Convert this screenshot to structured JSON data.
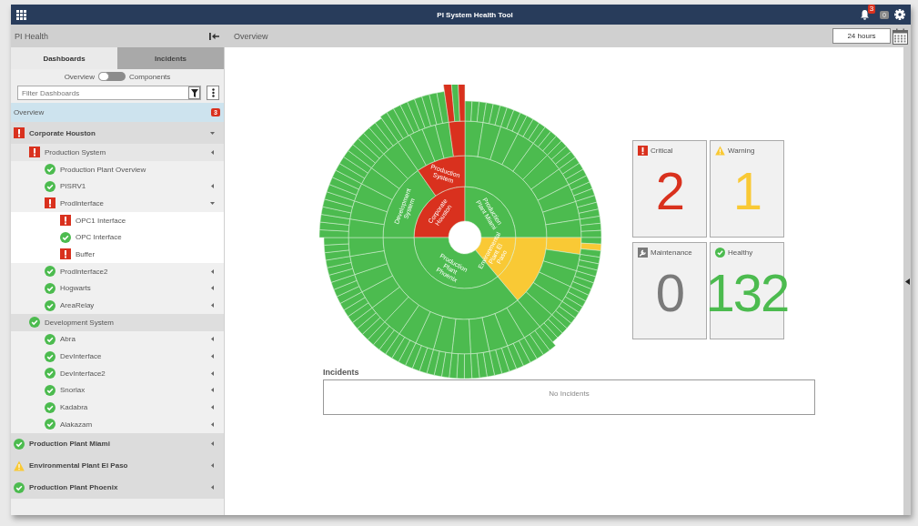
{
  "window": {
    "title": "PI System Health Tool"
  },
  "top_bar": {
    "notification_count": "3",
    "counter": "0"
  },
  "sidebar": {
    "title": "PI Health",
    "tabs": [
      {
        "label": "Dashboards",
        "selected": true
      },
      {
        "label": "Incidents",
        "selected": false
      }
    ],
    "toggle": {
      "left_label": "Overview",
      "right_label": "Components",
      "on": false
    },
    "filter": {
      "placeholder": "Filter Dashboards"
    },
    "overview": {
      "label": "Overview",
      "badge": "3",
      "selected": true
    },
    "tree": [
      {
        "label": "Corporate Houston",
        "kind": "critical",
        "expanded": true,
        "children": [
          {
            "label": "Production System",
            "kind": "critical",
            "expanded": false,
            "children": [
              {
                "label": "Production Plant Overview",
                "kind": "healthy"
              },
              {
                "label": "PISRV1",
                "kind": "healthy",
                "expanded": false
              },
              {
                "label": "ProdInterface",
                "kind": "critical",
                "expanded": true,
                "children": [
                  {
                    "label": "OPC1 Interface",
                    "kind": "critical"
                  },
                  {
                    "label": "OPC Interface",
                    "kind": "healthy"
                  },
                  {
                    "label": "Buffer",
                    "kind": "critical"
                  }
                ]
              },
              {
                "label": "ProdInterface2",
                "kind": "healthy",
                "expanded": false
              },
              {
                "label": "Hogwarts",
                "kind": "healthy",
                "expanded": false
              },
              {
                "label": "AreaRelay",
                "kind": "healthy",
                "expanded": false
              }
            ]
          },
          {
            "label": "Development System",
            "kind": "healthy",
            "children": [
              {
                "label": "Abra",
                "kind": "healthy",
                "expanded": false
              },
              {
                "label": "DevInterface",
                "kind": "healthy",
                "expanded": false
              },
              {
                "label": "DevInterface2",
                "kind": "healthy",
                "expanded": false
              },
              {
                "label": "Snorlax",
                "kind": "healthy",
                "expanded": false
              },
              {
                "label": "Kadabra",
                "kind": "healthy",
                "expanded": false
              },
              {
                "label": "Alakazam",
                "kind": "healthy",
                "expanded": false
              }
            ]
          }
        ]
      },
      {
        "label": "Production Plant Miami",
        "kind": "healthy",
        "expanded": false
      },
      {
        "label": "Environmental Plant El Paso",
        "kind": "warning",
        "expanded": false
      },
      {
        "label": "Production Plant Phoenix",
        "kind": "healthy",
        "expanded": false
      }
    ]
  },
  "header": {
    "title": "Overview",
    "range": "24 hours"
  },
  "sunburst": {
    "segments": [
      {
        "label": "Corporate Houston",
        "kind": "critical"
      },
      {
        "label": "Production Plant Miami",
        "kind": "healthy"
      },
      {
        "label": "Environmental Plant El Paso",
        "kind": "warning"
      },
      {
        "label": "Production Plant Phoenix",
        "kind": "healthy"
      }
    ],
    "subsegments": [
      {
        "label": "Development System",
        "kind": "healthy"
      },
      {
        "label": "Production System",
        "kind": "critical"
      }
    ]
  },
  "summary": [
    {
      "label": "Critical",
      "kind": "critical",
      "count": "2"
    },
    {
      "label": "Warning",
      "kind": "warning",
      "count": "1"
    },
    {
      "label": "Maintenance",
      "kind": "maintenance",
      "count": "0"
    },
    {
      "label": "Healthy",
      "kind": "healthy",
      "count": "132"
    }
  ],
  "incidents": {
    "title": "Incidents",
    "empty_text": "No Incidents"
  }
}
